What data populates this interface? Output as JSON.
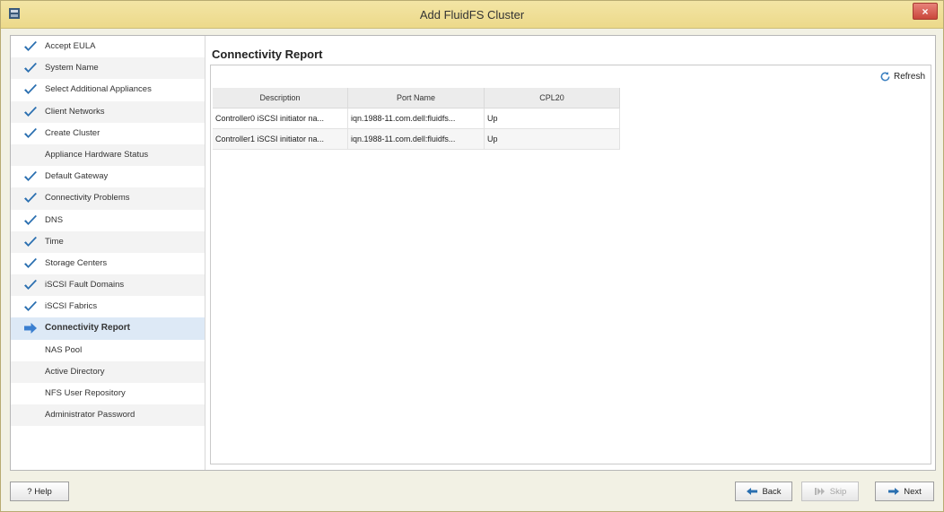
{
  "window": {
    "title": "Add FluidFS Cluster",
    "close_label": "×"
  },
  "sidebar": {
    "steps": [
      {
        "label": "Accept EULA",
        "state": "done"
      },
      {
        "label": "System Name",
        "state": "done"
      },
      {
        "label": "Select Additional Appliances",
        "state": "done"
      },
      {
        "label": "Client Networks",
        "state": "done"
      },
      {
        "label": "Create Cluster",
        "state": "done"
      },
      {
        "label": "Appliance Hardware Status",
        "state": "pending"
      },
      {
        "label": "Default Gateway",
        "state": "done"
      },
      {
        "label": "Connectivity Problems",
        "state": "done"
      },
      {
        "label": "DNS",
        "state": "done"
      },
      {
        "label": "Time",
        "state": "done"
      },
      {
        "label": "Storage Centers",
        "state": "done"
      },
      {
        "label": "iSCSI Fault Domains",
        "state": "done"
      },
      {
        "label": "iSCSI Fabrics",
        "state": "done"
      },
      {
        "label": "Connectivity Report",
        "state": "current"
      },
      {
        "label": "NAS Pool",
        "state": "pending"
      },
      {
        "label": "Active Directory",
        "state": "pending"
      },
      {
        "label": "NFS User Repository",
        "state": "pending"
      },
      {
        "label": "Administrator Password",
        "state": "pending"
      }
    ]
  },
  "main": {
    "title": "Connectivity Report",
    "refresh_label": "Refresh",
    "table": {
      "columns": [
        "Description",
        "Port Name",
        "CPL20"
      ],
      "rows": [
        [
          "Controller0 iSCSI initiator na...",
          "iqn.1988-11.com.dell:fluidfs...",
          "Up"
        ],
        [
          "Controller1 iSCSI initiator na...",
          "iqn.1988-11.com.dell:fluidfs...",
          "Up"
        ]
      ]
    }
  },
  "footer": {
    "help_label": "? Help",
    "back_label": "Back",
    "skip_label": "Skip",
    "next_label": "Next"
  },
  "colors": {
    "titlebar": "#ecd98a",
    "check": "#2a6fb0",
    "current_row": "#dde9f6"
  },
  "icons": {
    "done": "checkmark-icon",
    "current": "arrow-right-icon",
    "refresh": "refresh-icon",
    "back": "arrow-left-icon",
    "skip": "skip-icon",
    "next": "arrow-right-icon"
  }
}
